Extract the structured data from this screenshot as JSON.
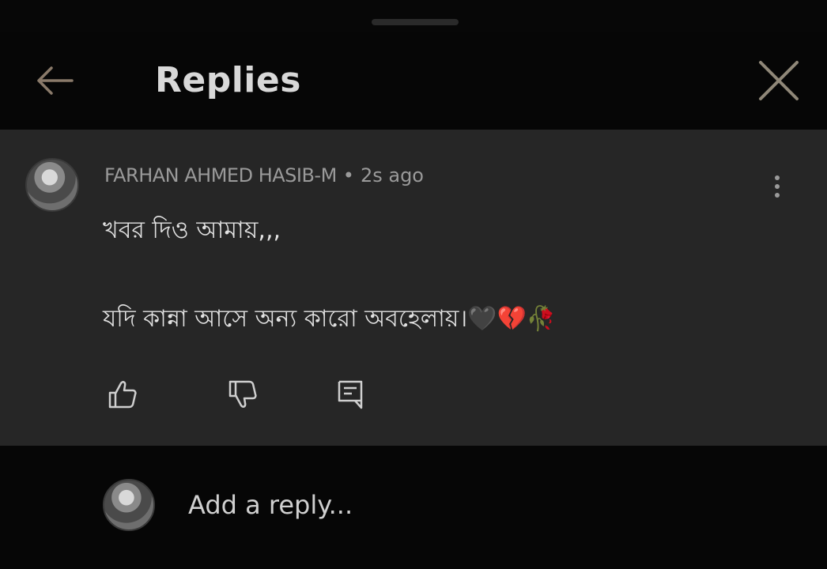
{
  "header": {
    "title": "Replies",
    "back_icon": "arrow-left-icon",
    "close_icon": "close-icon"
  },
  "comment": {
    "author": "FARHAN AHMED HASIB-M",
    "separator": "•",
    "time": "2s ago",
    "text": "খবর দিও আমায়,,,\n\nযদি কান্না আসে অন্য কারো অবহেলায়।🖤💔🥀",
    "actions": {
      "like_icon": "thumbs-up-icon",
      "dislike_icon": "thumbs-down-icon",
      "reply_icon": "reply-comment-icon"
    }
  },
  "reply_bar": {
    "placeholder": "Add a reply..."
  },
  "colors": {
    "background": "#070707",
    "panel": "#262626",
    "text": "#e2e2e2",
    "muted": "#9a9a9a"
  }
}
